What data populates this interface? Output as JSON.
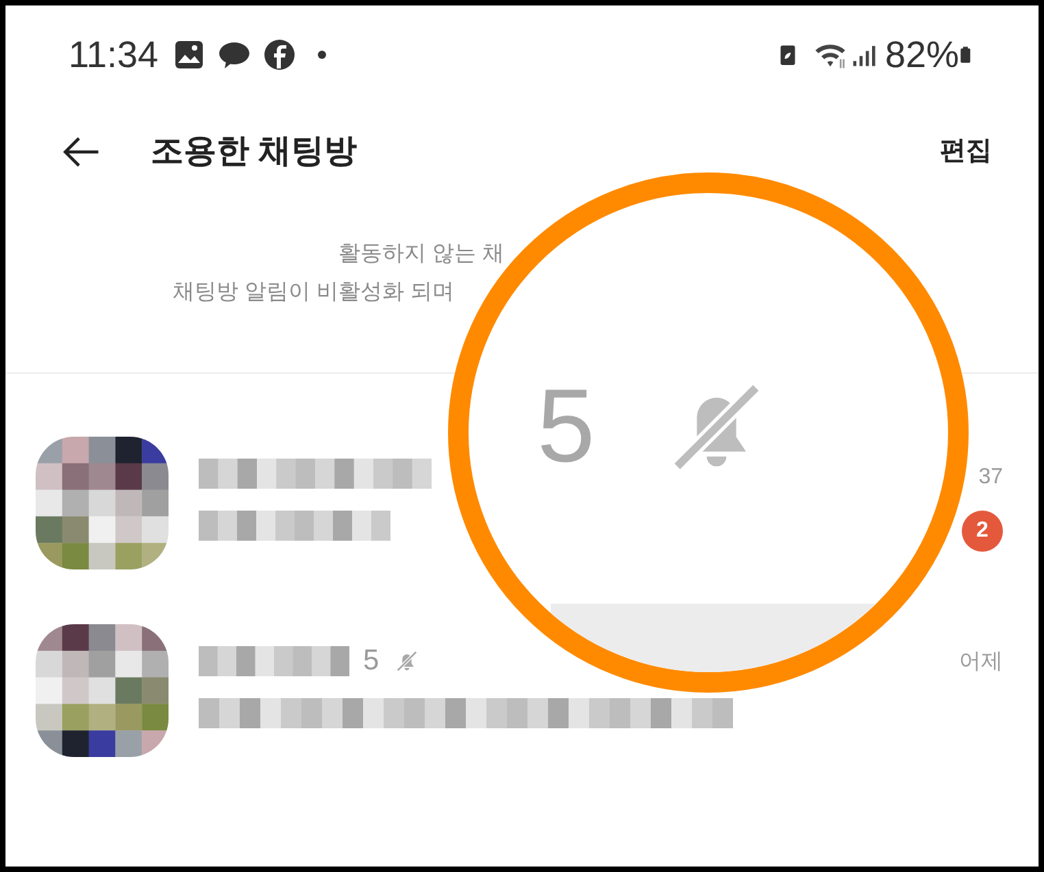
{
  "status_bar": {
    "time": "11:34",
    "battery": "82%"
  },
  "header": {
    "title": "조용한 채팅방",
    "action": "편집"
  },
  "notice": [
    "활동하지 않는 채",
    "채팅방 알림이 비활성화 되며"
  ],
  "chats": [
    {
      "time": "37",
      "unread": "2",
      "muted": false
    },
    {
      "member_count": "5",
      "muted": true,
      "time": "어제"
    }
  ],
  "magnifier": {
    "count": "5",
    "muted": true
  }
}
